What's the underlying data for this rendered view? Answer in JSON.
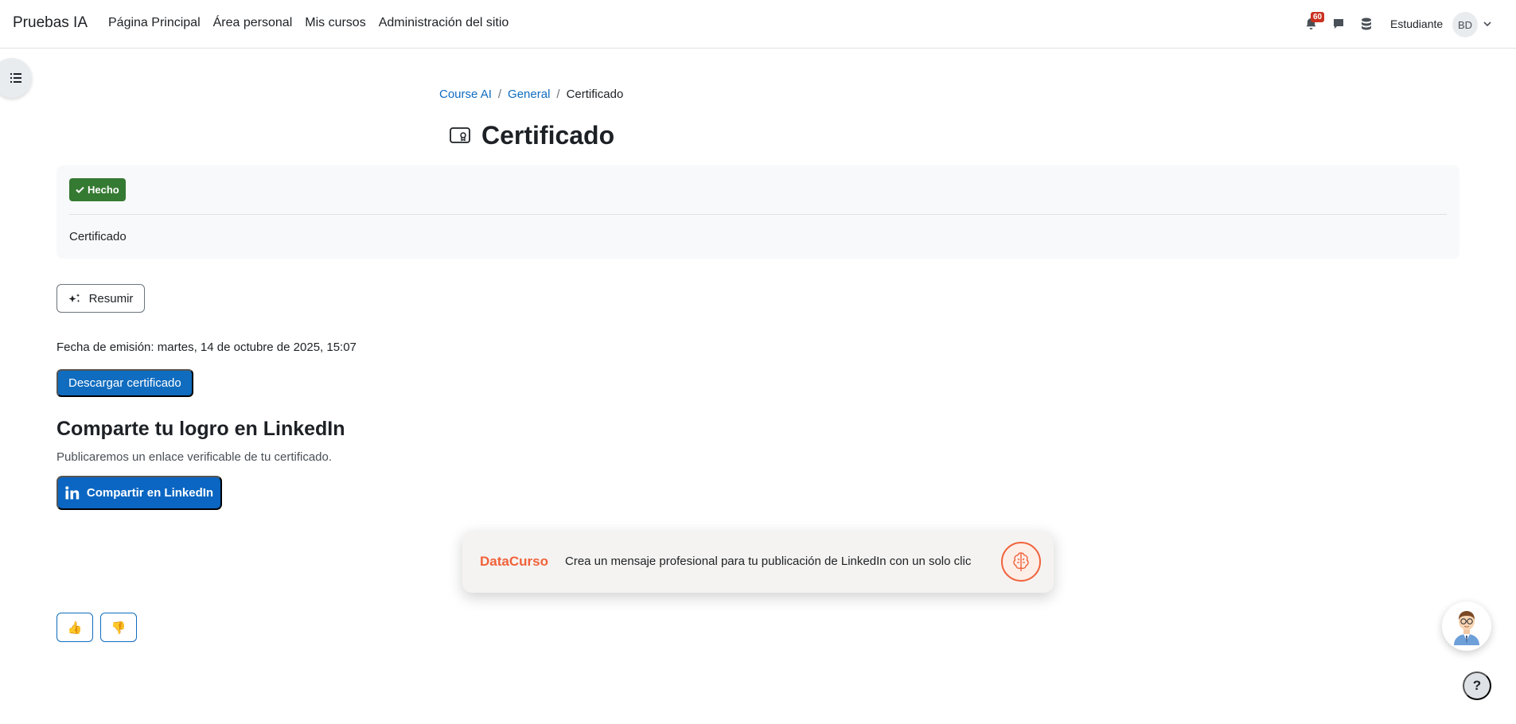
{
  "navbar": {
    "brand": "Pruebas IA",
    "links": [
      "Página Principal",
      "Área personal",
      "Mis cursos",
      "Administración del sitio"
    ],
    "notification_count": "60",
    "role": "Estudiante",
    "avatar_initials": "BD"
  },
  "breadcrumb": {
    "items": [
      "Course AI",
      "General",
      "Certificado"
    ],
    "separator": "/"
  },
  "page": {
    "title": "Certificado"
  },
  "activity": {
    "completion_label": "Hecho",
    "description": "Certificado"
  },
  "summarize_label": "Resumir",
  "issue_date": "Fecha de emisión: martes, 14 de octubre de 2025, 15:07",
  "download_label": "Descargar certificado",
  "share": {
    "title": "Comparte tu logro en LinkedIn",
    "description": "Publicaremos un enlace verificable de tu certificado.",
    "button_label": "Compartir en LinkedIn"
  },
  "toast": {
    "brand": "DataCurso",
    "message": "Crea un mensaje profesional para tu publicación de LinkedIn con un solo clic"
  },
  "feedback": {
    "like": "👍",
    "dislike": "👎"
  },
  "help_label": "?",
  "colors": {
    "primary": "#0f6cbf",
    "success": "#357a32",
    "linkedin": "#0a66c2",
    "accent": "#f0623a",
    "badge": "#ca3120"
  }
}
